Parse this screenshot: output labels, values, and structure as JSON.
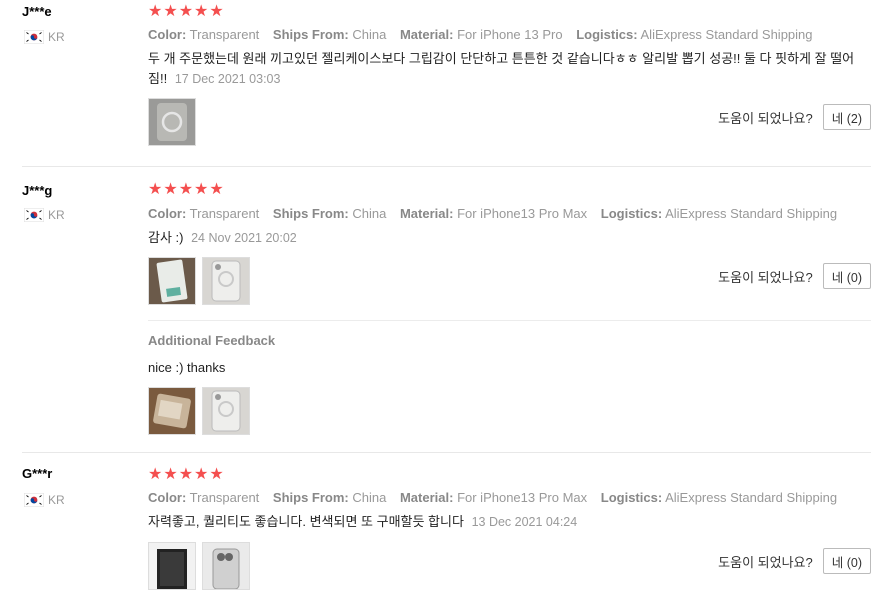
{
  "labels": {
    "color": "Color:",
    "ships_from": "Ships From:",
    "material": "Material:",
    "logistics": "Logistics:",
    "helpful": "도움이 되었나요?",
    "additional_feedback": "Additional Feedback"
  },
  "star_color": "#f44f4f",
  "reviews": [
    {
      "user": "J***e",
      "country": "KR",
      "rating": 5,
      "color": "Transparent",
      "ships_from": "China",
      "material": "For iPhone 13 Pro",
      "logistics": "AliExpress Standard Shipping",
      "text": "두 개 주문했는데 원래 끼고있던 젤리케이스보다 그립감이 단단하고 튼튼한 것 같습니다ㅎㅎ 알리발 뽑기 성공!! 둘 다 핏하게 잘 떨어짐!!",
      "date": "17 Dec 2021 03:03",
      "helpful_button": "네 (2)"
    },
    {
      "user": "J***g",
      "country": "KR",
      "rating": 5,
      "color": "Transparent",
      "ships_from": "China",
      "material": "For iPhone13 Pro Max",
      "logistics": "AliExpress Standard Shipping",
      "text": "감사 :)",
      "date": "24 Nov 2021 20:02",
      "helpful_button": "네 (0)",
      "additional_text": "nice :) thanks"
    },
    {
      "user": "G***r",
      "country": "KR",
      "rating": 5,
      "color": "Transparent",
      "ships_from": "China",
      "material": "For iPhone13 Pro Max",
      "logistics": "AliExpress Standard Shipping",
      "text": "자력좋고, 퀄리티도 좋습니다. 변색되면 또 구매할듯 합니다",
      "date": "13 Dec 2021 04:24",
      "helpful_button": "네 (0)"
    }
  ]
}
